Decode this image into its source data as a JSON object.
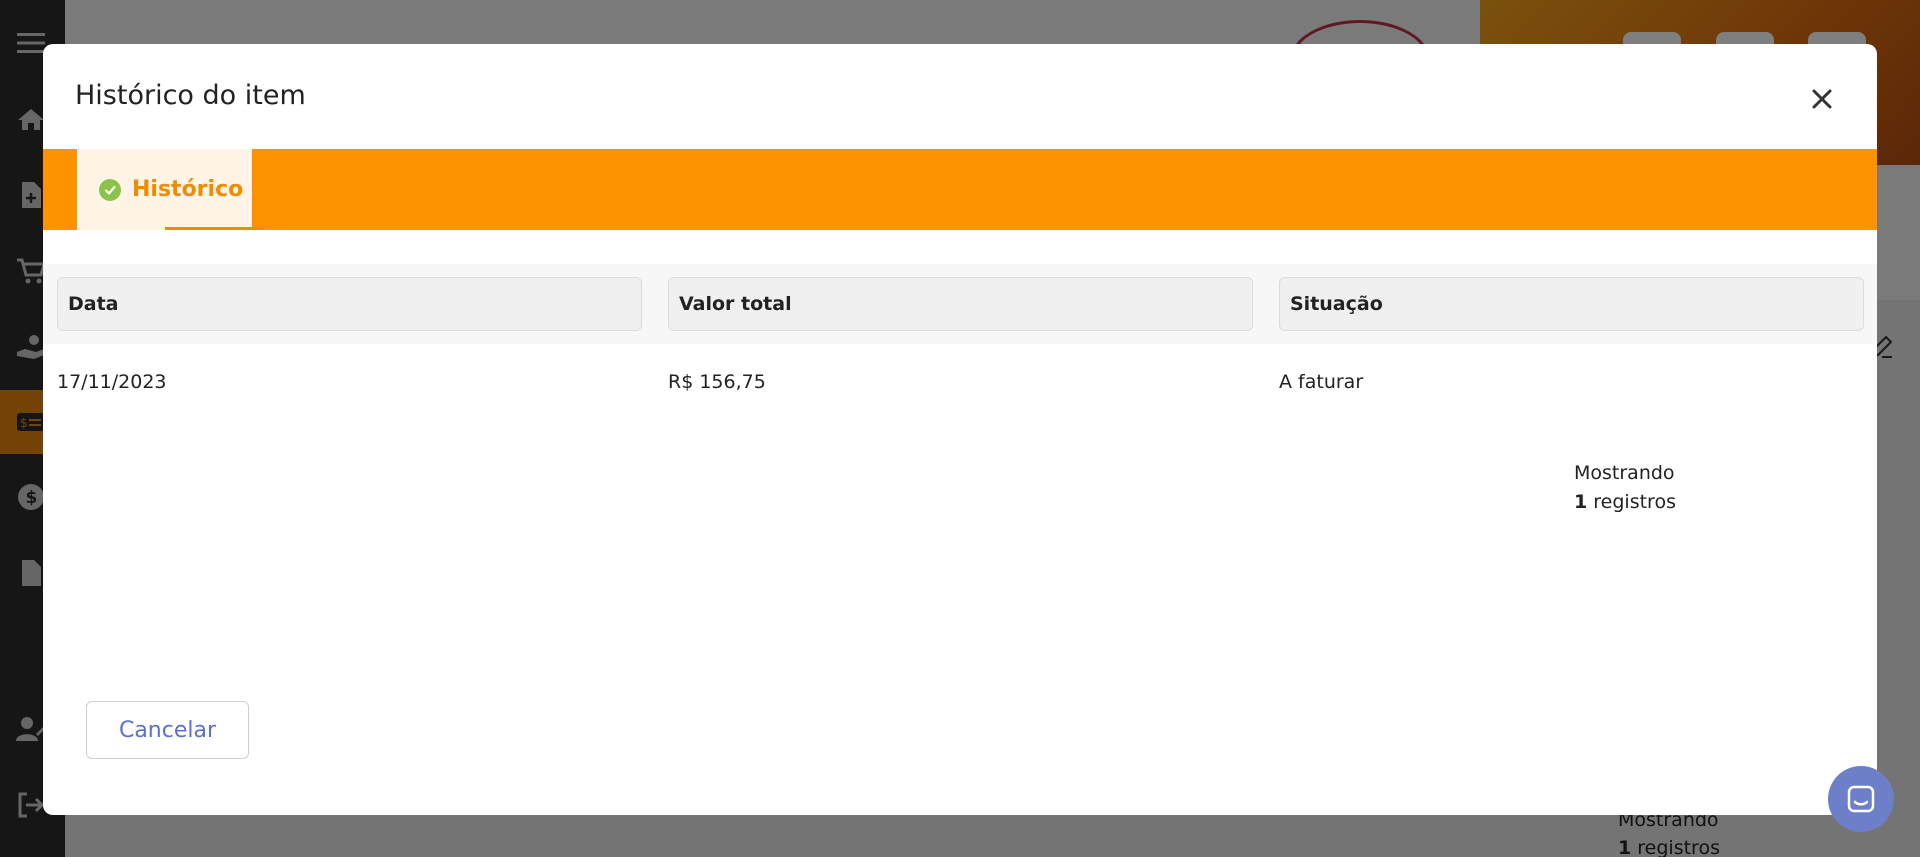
{
  "modal": {
    "title": "Histórico do item",
    "tabs": [
      {
        "label": "Histórico",
        "active": true
      }
    ],
    "table": {
      "columns": [
        "Data",
        "Valor total",
        "Situação"
      ],
      "rows": [
        {
          "data": "17/11/2023",
          "valor_total": "R$ 156,75",
          "situacao": "A faturar"
        }
      ]
    },
    "summary": {
      "prefix": "Mostrando",
      "count": "1",
      "suffix": "registros"
    },
    "cancel_label": "Cancelar"
  },
  "background": {
    "summary": {
      "prefix": "Mostrando",
      "count": "1",
      "suffix": "registros"
    }
  },
  "colors": {
    "accent_orange": "#fe9301",
    "tab_text": "#f08c00",
    "check_green": "#8bc34a",
    "cancel_text": "#5b6fd6",
    "chat_button": "#6c7fc8"
  },
  "icons": [
    "menu-icon",
    "home-icon",
    "file-plus-icon",
    "cart-icon",
    "hand-money-icon",
    "money-card-icon",
    "dollar-icon",
    "document-icon",
    "user-edit-icon",
    "logout-icon",
    "close-icon",
    "check-circle-icon",
    "chat-icon",
    "edit-icon"
  ]
}
